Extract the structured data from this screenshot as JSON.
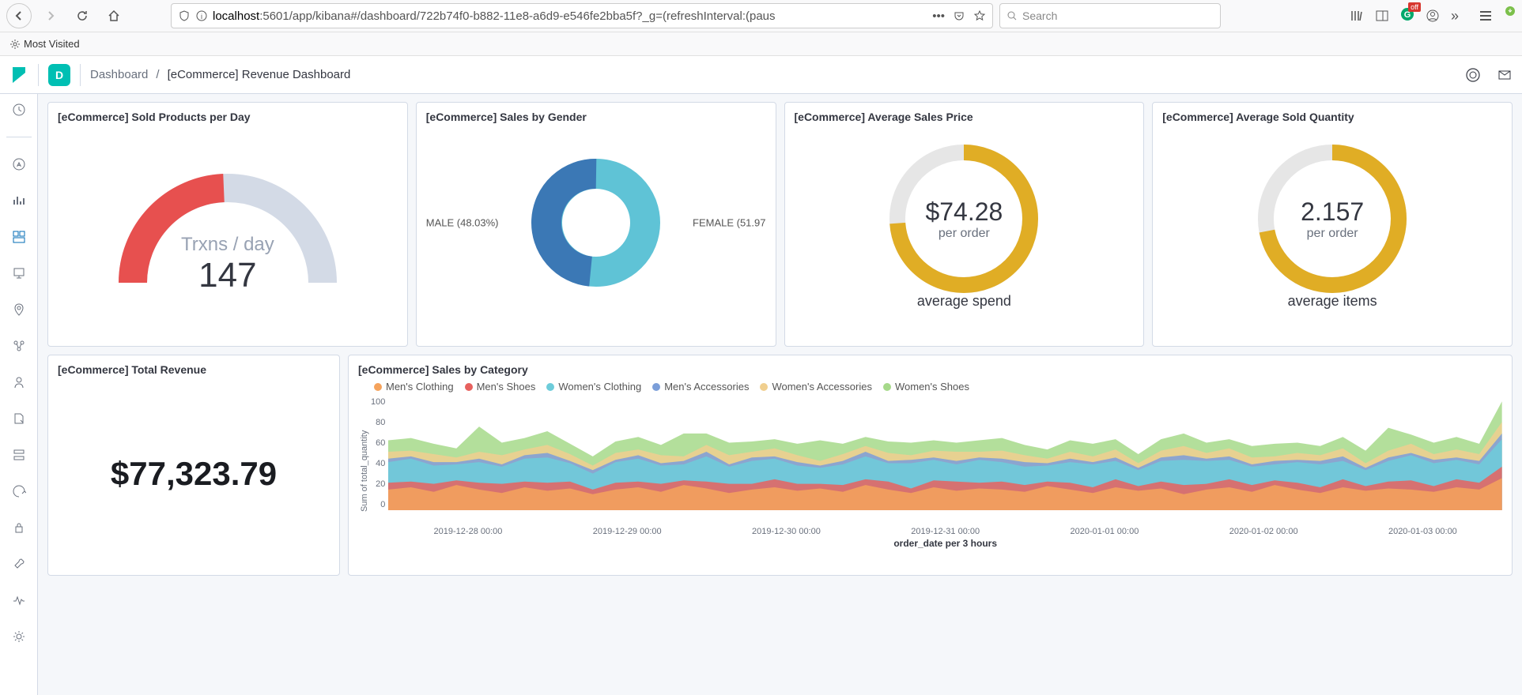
{
  "browser": {
    "url_prefix": "localhost",
    "url_port": ":5601",
    "url_path": "/app/kibana#/dashboard/722b74f0-b882-11e8-a6d9-e546fe2bba5f?_g=(refreshInterval:(paus",
    "search_placeholder": "Search",
    "bookmark_most_visited": "Most Visited"
  },
  "header": {
    "space": "D",
    "crumb_dashboard": "Dashboard",
    "crumb_sep": "/",
    "crumb_current": "[eCommerce] Revenue Dashboard"
  },
  "panels": {
    "sold_per_day": {
      "title": "[eCommerce] Sold Products per Day",
      "subtitle": "Trxns / day",
      "value": "147"
    },
    "by_gender": {
      "title": "[eCommerce] Sales by Gender",
      "left_label": "MALE (48.03%)",
      "right_label": "FEMALE (51.97"
    },
    "avg_price": {
      "title": "[eCommerce] Average Sales Price",
      "value": "$74.28",
      "sub": "per order",
      "footer": "average spend"
    },
    "avg_qty": {
      "title": "[eCommerce] Average Sold Quantity",
      "value": "2.157",
      "sub": "per order",
      "footer": "average items"
    },
    "total_revenue": {
      "title": "[eCommerce] Total Revenue",
      "value": "$77,323.79"
    },
    "by_category": {
      "title": "[eCommerce] Sales by Category",
      "ylabel": "Sum of total_quantity",
      "xlabel": "order_date per 3 hours",
      "legend": [
        "Men's Clothing",
        "Men's Shoes",
        "Women's Clothing",
        "Men's Accessories",
        "Women's Accessories",
        "Women's Shoes"
      ],
      "yticks": [
        "100",
        "80",
        "60",
        "40",
        "20",
        "0"
      ],
      "xticks": [
        "2019-12-28 00:00",
        "2019-12-29 00:00",
        "2019-12-30 00:00",
        "2019-12-31 00:00",
        "2020-01-01 00:00",
        "2020-01-02 00:00",
        "2020-01-03 00:00"
      ]
    }
  },
  "colors": {
    "legend": [
      "#f5a35c",
      "#e7615e",
      "#6dccda",
      "#7b9ed9",
      "#f0cf8f",
      "#a6d98a"
    ],
    "gauge_fill": "#e7504f",
    "gauge_track": "#d3dae6",
    "donut_male": "#3b78b5",
    "donut_female": "#5fc3d6",
    "goal_fill": "#e0ad25",
    "goal_track": "#e6e6e6"
  },
  "chart_data": [
    {
      "type": "gauge",
      "title": "[eCommerce] Sold Products per Day",
      "value": 147,
      "range": [
        0,
        300
      ],
      "label": "Trxns / day"
    },
    {
      "type": "pie",
      "title": "[eCommerce] Sales by Gender",
      "categories": [
        "MALE",
        "FEMALE"
      ],
      "values": [
        48.03,
        51.97
      ]
    },
    {
      "type": "goal",
      "title": "[eCommerce] Average Sales Price",
      "value": 74.28,
      "proportion": 0.74,
      "unit": "$",
      "sub": "per order",
      "footer": "average spend"
    },
    {
      "type": "goal",
      "title": "[eCommerce] Average Sold Quantity",
      "value": 2.157,
      "proportion": 0.72,
      "sub": "per order",
      "footer": "average items"
    },
    {
      "type": "metric",
      "title": "[eCommerce] Total Revenue",
      "value": 77323.79,
      "formatted": "$77,323.79"
    },
    {
      "type": "area",
      "title": "[eCommerce] Sales by Category",
      "xlabel": "order_date per 3 hours",
      "ylabel": "Sum of total_quantity",
      "ylim": [
        0,
        100
      ],
      "x": [
        "2019-12-28 00:00",
        "2019-12-29 00:00",
        "2019-12-30 00:00",
        "2019-12-31 00:00",
        "2020-01-01 00:00",
        "2020-01-02 00:00",
        "2020-01-03 00:00"
      ],
      "series": [
        {
          "name": "Men's Clothing",
          "color": "#f5a35c",
          "values": [
            18,
            20,
            16,
            22,
            18,
            15,
            20,
            17,
            19,
            14,
            18,
            20,
            16,
            22,
            19,
            15,
            18,
            20,
            17,
            19,
            16,
            22,
            18,
            15,
            20,
            17,
            19,
            18,
            16,
            21,
            18,
            15,
            20,
            17,
            19,
            14,
            18,
            20,
            16,
            22,
            18,
            15,
            20,
            17,
            19,
            18,
            16,
            20,
            18,
            28
          ]
        },
        {
          "name": "Men's Shoes",
          "color": "#e7615e",
          "values": [
            6,
            5,
            7,
            4,
            6,
            8,
            5,
            7,
            6,
            4,
            6,
            5,
            7,
            4,
            6,
            8,
            5,
            7,
            6,
            4,
            6,
            5,
            7,
            4,
            6,
            8,
            5,
            7,
            6,
            4,
            6,
            5,
            7,
            4,
            6,
            8,
            5,
            7,
            6,
            4,
            6,
            5,
            7,
            4,
            6,
            8,
            5,
            7,
            6,
            10
          ]
        },
        {
          "name": "Women's Clothing",
          "color": "#6dccda",
          "values": [
            18,
            20,
            16,
            14,
            18,
            15,
            20,
            22,
            16,
            14,
            18,
            20,
            16,
            14,
            22,
            15,
            20,
            18,
            16,
            14,
            18,
            20,
            16,
            22,
            18,
            15,
            20,
            17,
            16,
            14,
            18,
            20,
            16,
            14,
            18,
            22,
            20,
            17,
            16,
            14,
            18,
            20,
            16,
            14,
            18,
            22,
            20,
            17,
            16,
            24
          ]
        },
        {
          "name": "Men's Accessories",
          "color": "#7b9ed9",
          "values": [
            3,
            2,
            3,
            2,
            3,
            2,
            3,
            4,
            2,
            3,
            2,
            3,
            2,
            3,
            4,
            2,
            3,
            2,
            3,
            2,
            3,
            4,
            2,
            3,
            2,
            3,
            2,
            3,
            4,
            2,
            3,
            2,
            3,
            2,
            3,
            4,
            2,
            3,
            2,
            3,
            2,
            3,
            4,
            2,
            3,
            2,
            3,
            2,
            3,
            5
          ]
        },
        {
          "name": "Women's Accessories",
          "color": "#f0cf8f",
          "values": [
            6,
            5,
            7,
            4,
            6,
            8,
            5,
            7,
            6,
            4,
            6,
            5,
            7,
            4,
            6,
            8,
            5,
            7,
            6,
            4,
            6,
            5,
            7,
            4,
            6,
            8,
            5,
            7,
            6,
            4,
            6,
            5,
            7,
            4,
            6,
            8,
            5,
            7,
            6,
            4,
            6,
            5,
            7,
            4,
            6,
            8,
            5,
            7,
            6,
            10
          ]
        },
        {
          "name": "Women's Shoes",
          "color": "#a6d98a",
          "values": [
            10,
            11,
            9,
            8,
            22,
            11,
            10,
            12,
            9,
            8,
            10,
            11,
            9,
            20,
            10,
            11,
            9,
            8,
            10,
            18,
            9,
            8,
            10,
            11,
            9,
            8,
            10,
            11,
            9,
            8,
            10,
            11,
            9,
            8,
            10,
            11,
            9,
            8,
            10,
            11,
            9,
            8,
            10,
            11,
            20,
            8,
            10,
            11,
            9,
            18
          ]
        }
      ]
    }
  ]
}
